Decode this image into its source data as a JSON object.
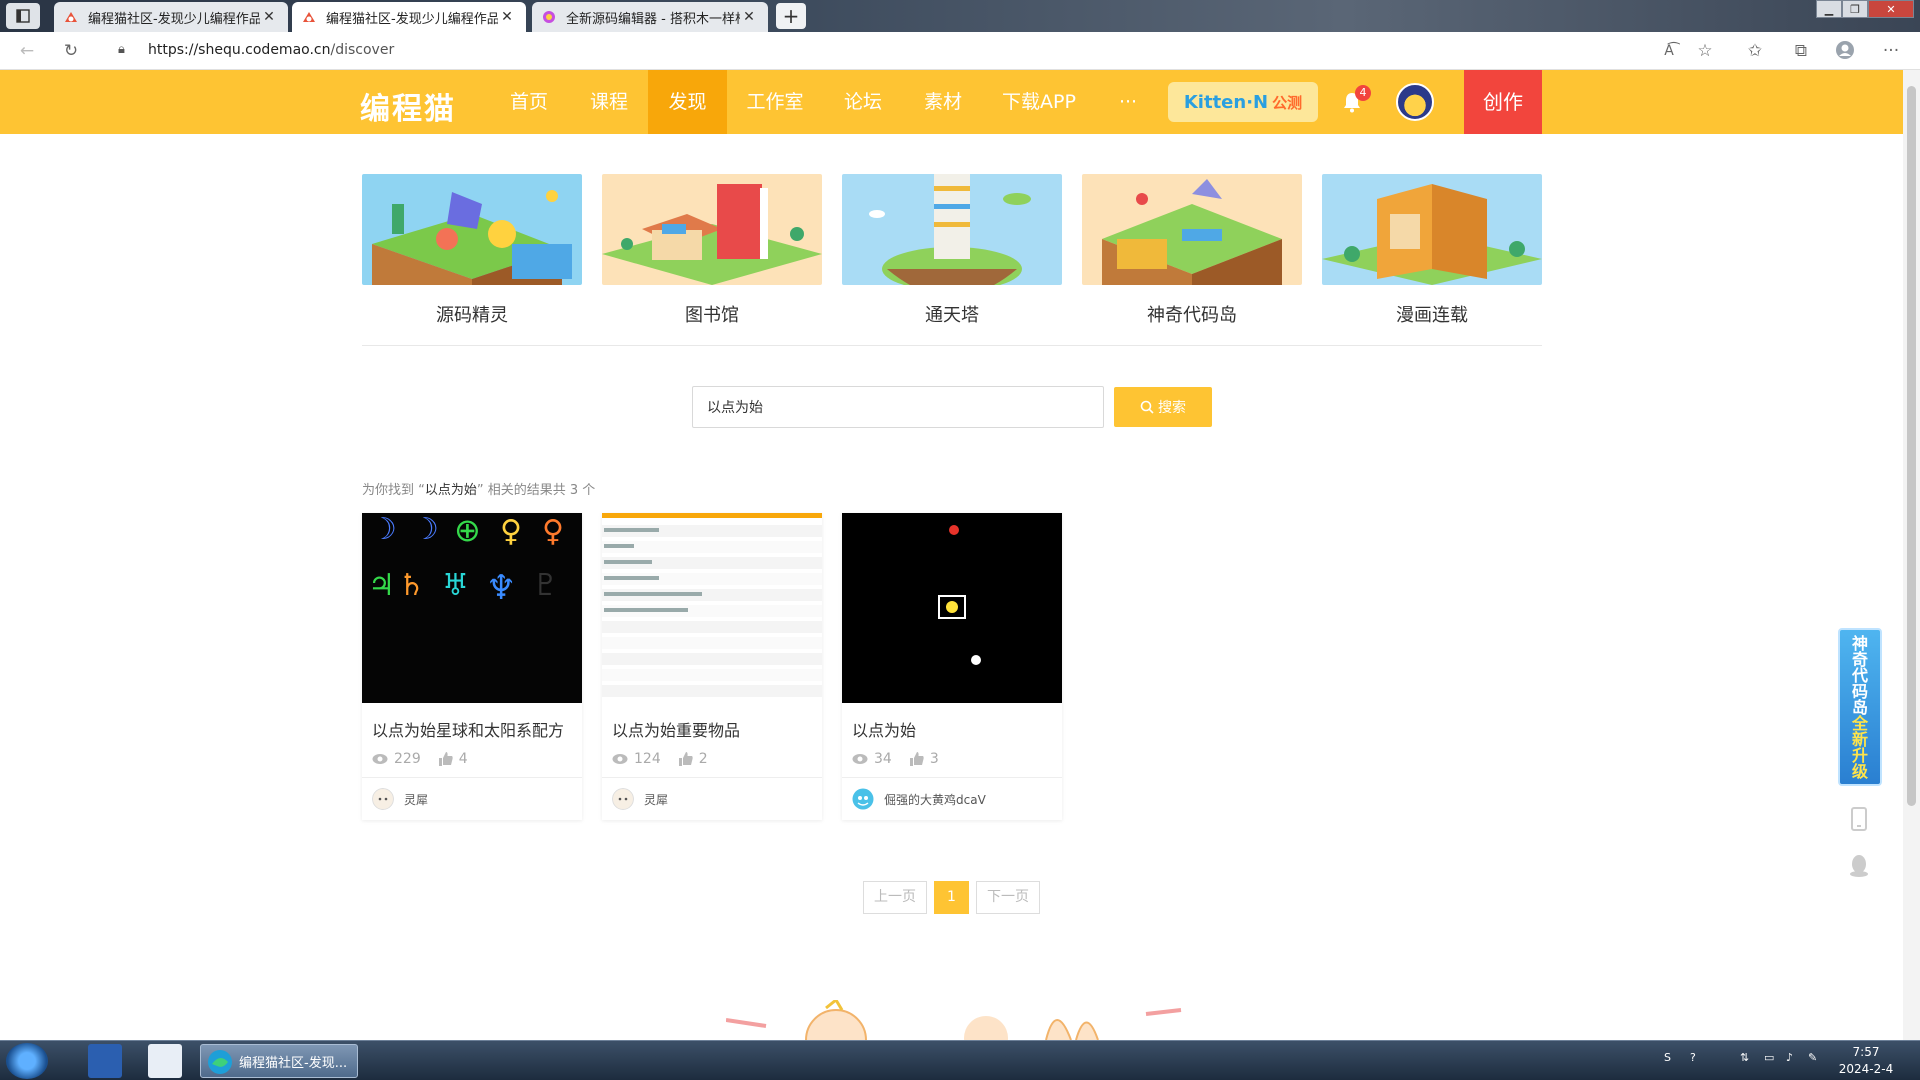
{
  "browser": {
    "tabs": [
      {
        "title": "编程猫社区-发现少儿编程作品",
        "active": false
      },
      {
        "title": "编程猫社区-发现少儿编程作品",
        "active": true
      },
      {
        "title": "全新源码编辑器 - 搭积木一样构",
        "active": false
      }
    ],
    "url_host": "https://shequ.codemao.cn",
    "url_path": "/discover"
  },
  "header": {
    "logo": "编程猫",
    "nav": [
      {
        "label": "首页",
        "active": false
      },
      {
        "label": "课程",
        "active": false
      },
      {
        "label": "发现",
        "active": true
      },
      {
        "label": "工作室",
        "active": false
      },
      {
        "label": "论坛",
        "active": false
      },
      {
        "label": "素材",
        "active": false
      },
      {
        "label": "下载APP",
        "active": false
      },
      {
        "label": "···",
        "active": false
      }
    ],
    "kitten_label": "Kitten·N",
    "kitten_badge": "公测",
    "notification_count": "4",
    "create_label": "创作"
  },
  "features": [
    {
      "label": "源码精灵"
    },
    {
      "label": "图书馆"
    },
    {
      "label": "通天塔"
    },
    {
      "label": "神奇代码岛"
    },
    {
      "label": "漫画连载"
    }
  ],
  "search": {
    "value": "以点为始",
    "button_label": "搜索"
  },
  "results": {
    "prefix": "为你找到 “",
    "keyword": "以点为始",
    "suffix": "” 相关的结果共 3 个"
  },
  "works": [
    {
      "title": "以点为始星球和太阳系配方",
      "views": "229",
      "likes": "4",
      "author": "灵犀"
    },
    {
      "title": "以点为始重要物品",
      "views": "124",
      "likes": "2",
      "author": "灵犀"
    },
    {
      "title": "以点为始",
      "views": "34",
      "likes": "3",
      "author": "倔强的大黄鸡dcaV"
    }
  ],
  "pagination": {
    "prev": "上一页",
    "current": "1",
    "next": "下一页"
  },
  "side_banner": {
    "text_a": "神奇代码岛",
    "text_b": "全新升级"
  },
  "taskbar": {
    "active_app": "编程猫社区-发现...",
    "time": "7:57",
    "date": "2024-2-4"
  },
  "colors": {
    "brand_yellow": "#fec433",
    "nav_active": "#f8a70a",
    "create_red": "#f2453d"
  }
}
